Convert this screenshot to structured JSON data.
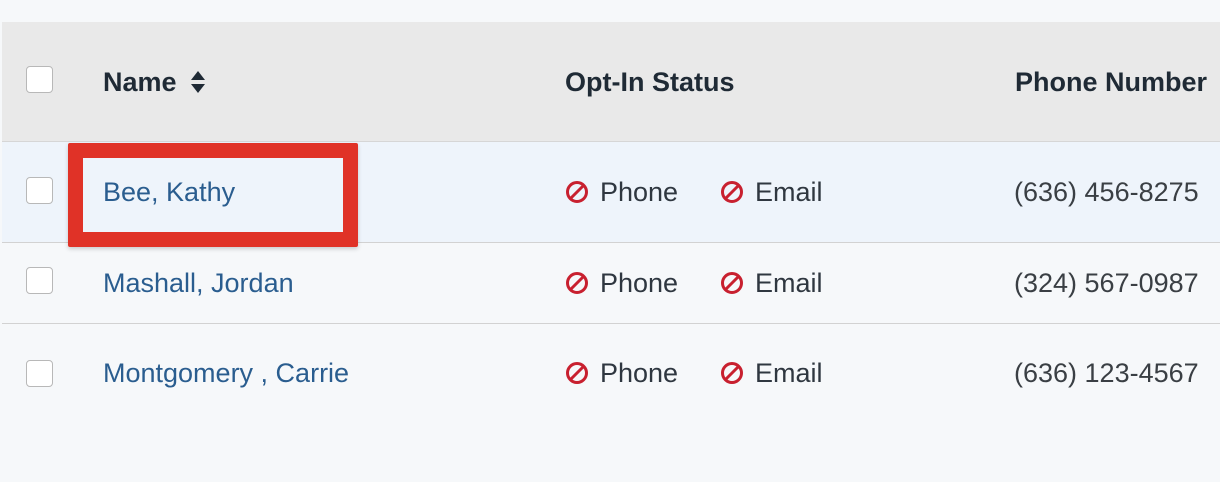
{
  "table": {
    "columns": {
      "name": "Name",
      "opt_in": "Opt-In Status",
      "phone": "Phone Number"
    },
    "rows": [
      {
        "name": "Bee, Kathy",
        "opt_phone": "Phone",
        "opt_email": "Email",
        "phone": "(636) 456-8275"
      },
      {
        "name": "Mashall, Jordan",
        "opt_phone": "Phone",
        "opt_email": "Email",
        "phone": "(324) 567-0987"
      },
      {
        "name": "Montgomery , Carrie",
        "opt_phone": "Phone",
        "opt_email": "Email",
        "phone": "(636) 123-4567"
      }
    ]
  },
  "icons": {
    "sort": "sort-icon",
    "opt_out": "not-allowed-icon"
  },
  "colors": {
    "link": "#2a5d8f",
    "opt_out_icon": "#c8202f",
    "highlight": "#e03227",
    "header_bg": "#e9e9e9",
    "selected_row_bg": "#eef4fb"
  }
}
